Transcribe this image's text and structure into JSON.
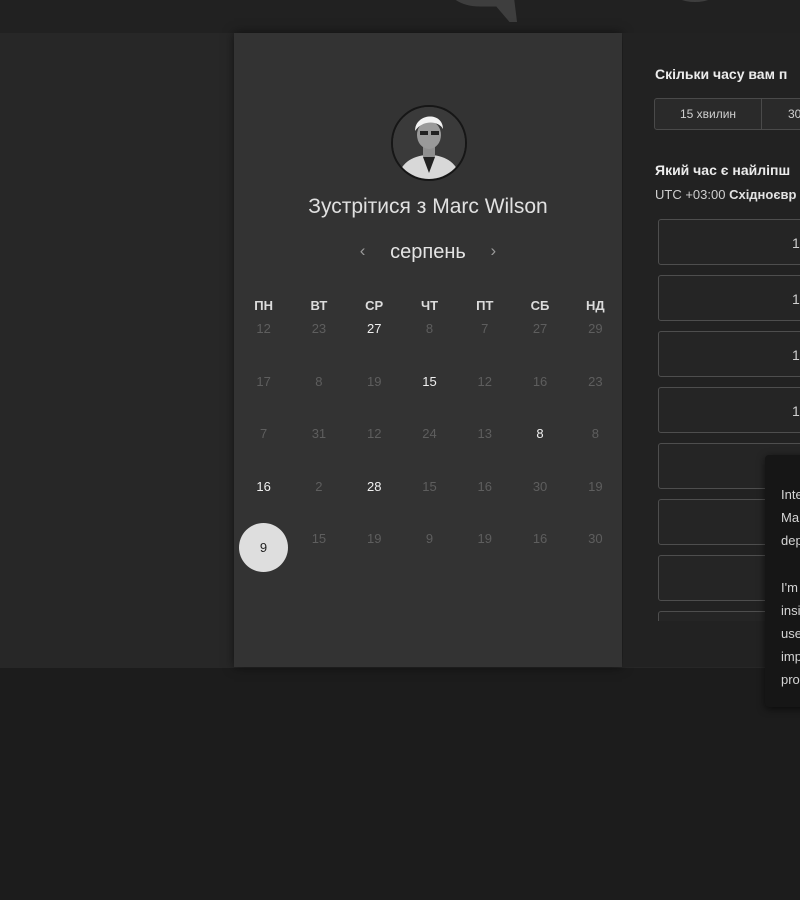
{
  "booking": {
    "title": "Зустрітися з Marc Wilson",
    "month": "серпень",
    "nav": {
      "prev": "‹",
      "next": "›"
    },
    "weekdays": [
      "ПН",
      "ВТ",
      "СР",
      "ЧТ",
      "ПТ",
      "СБ",
      "НД"
    ],
    "weeks": [
      [
        {
          "d": "12",
          "a": false
        },
        {
          "d": "23",
          "a": false
        },
        {
          "d": "27",
          "a": true
        },
        {
          "d": "8",
          "a": false
        },
        {
          "d": "7",
          "a": false
        },
        {
          "d": "27",
          "a": false
        },
        {
          "d": "29",
          "a": false
        }
      ],
      [
        {
          "d": "17",
          "a": false
        },
        {
          "d": "8",
          "a": false
        },
        {
          "d": "19",
          "a": false
        },
        {
          "d": "15",
          "a": true
        },
        {
          "d": "12",
          "a": false
        },
        {
          "d": "16",
          "a": false
        },
        {
          "d": "23",
          "a": false
        }
      ],
      [
        {
          "d": "7",
          "a": false
        },
        {
          "d": "31",
          "a": false
        },
        {
          "d": "12",
          "a": false
        },
        {
          "d": "24",
          "a": false
        },
        {
          "d": "13",
          "a": false
        },
        {
          "d": "8",
          "a": true
        },
        {
          "d": "8",
          "a": false
        }
      ],
      [
        {
          "d": "16",
          "a": true
        },
        {
          "d": "2",
          "a": false
        },
        {
          "d": "28",
          "a": true
        },
        {
          "d": "15",
          "a": false
        },
        {
          "d": "16",
          "a": false
        },
        {
          "d": "30",
          "a": false
        },
        {
          "d": "19",
          "a": false
        }
      ],
      [
        {
          "d": "9",
          "a": true,
          "sel": true
        },
        {
          "d": "15",
          "a": false
        },
        {
          "d": "19",
          "a": false
        },
        {
          "d": "9",
          "a": false
        },
        {
          "d": "19",
          "a": false
        },
        {
          "d": "16",
          "a": false
        },
        {
          "d": "30",
          "a": false
        }
      ]
    ]
  },
  "duration": {
    "question": "Скільки часу вам п",
    "options": [
      "15 хвилин",
      "30"
    ]
  },
  "time": {
    "question": "Який час є найліпш",
    "tz_offset": "UTC +03:00",
    "tz_name": "Східноєвр",
    "slots": [
      "1",
      "1",
      "1",
      "1",
      "",
      "",
      ""
    ]
  },
  "tooltip": {
    "lines": [
      "Inte",
      "Ma",
      "dep",
      "",
      "I'm",
      "insi",
      "use",
      "imp",
      "pro"
    ]
  }
}
